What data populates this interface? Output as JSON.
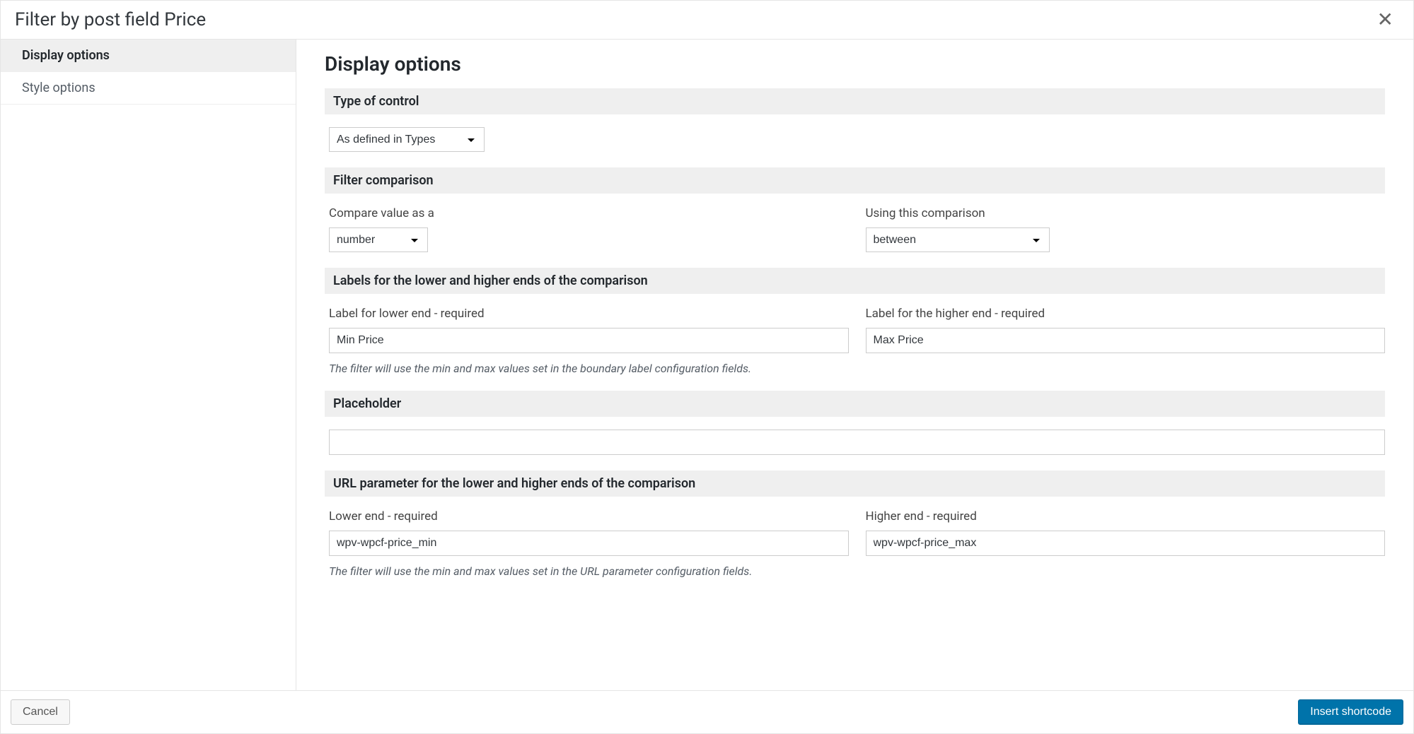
{
  "header": {
    "title": "Filter by post field Price"
  },
  "sidebar": {
    "items": [
      {
        "label": "Display options",
        "active": true
      },
      {
        "label": "Style options",
        "active": false
      }
    ]
  },
  "content": {
    "title": "Display options",
    "sections": {
      "type_of_control": {
        "header": "Type of control",
        "select_value": "As defined in Types"
      },
      "filter_comparison": {
        "header": "Filter comparison",
        "compare_label": "Compare value as a",
        "compare_value": "number",
        "using_label": "Using this comparison",
        "using_value": "between"
      },
      "labels": {
        "header": "Labels for the lower and higher ends of the comparison",
        "lower_label": "Label for lower end - required",
        "lower_value": "Min Price",
        "higher_label": "Label for the higher end - required",
        "higher_value": "Max Price",
        "hint": "The filter will use the min and max values set in the boundary label configuration fields."
      },
      "placeholder": {
        "header": "Placeholder",
        "value": ""
      },
      "url_params": {
        "header": "URL parameter for the lower and higher ends of the comparison",
        "lower_label": "Lower end - required",
        "lower_value": "wpv-wpcf-price_min",
        "higher_label": "Higher end - required",
        "higher_value": "wpv-wpcf-price_max",
        "hint": "The filter will use the min and max values set in the URL parameter configuration fields."
      }
    }
  },
  "footer": {
    "cancel": "Cancel",
    "insert": "Insert shortcode"
  }
}
